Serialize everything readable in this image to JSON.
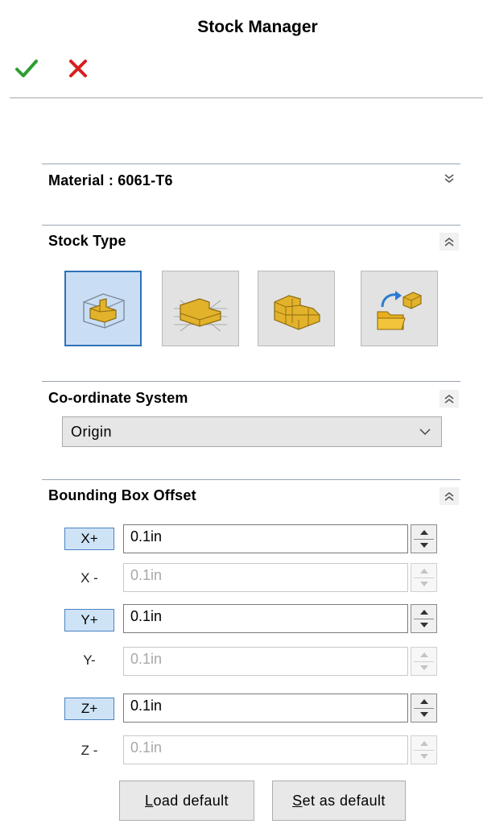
{
  "header": {
    "title": "Stock Manager"
  },
  "actions": {
    "ok_icon": "checkmark-icon",
    "cancel_icon": "close-icon",
    "ok_color": "#2e9e2e",
    "cancel_color": "#d81e1e"
  },
  "material": {
    "label": "Material : 6061-T6",
    "state": "collapsed"
  },
  "stock_type": {
    "label": "Stock Type",
    "state": "expanded",
    "options": [
      {
        "icon": "bounding-box-icon",
        "active": true
      },
      {
        "icon": "cylinder-stock-icon",
        "active": false
      },
      {
        "icon": "stl-stock-icon",
        "active": false
      },
      {
        "icon": "from-file-stock-icon",
        "active": false
      }
    ]
  },
  "coordinate_system": {
    "label": "Co-ordinate System",
    "state": "expanded",
    "selected": "Origin"
  },
  "bounding_box_offset": {
    "label": "Bounding Box Offset",
    "state": "expanded",
    "rows": [
      {
        "axis": "X+",
        "value": "0.1in",
        "enabled": true
      },
      {
        "axis": "X -",
        "value": "0.1in",
        "enabled": false
      },
      {
        "axis": "Y+",
        "value": "0.1in",
        "enabled": true
      },
      {
        "axis": "Y-",
        "value": "0.1in",
        "enabled": false
      },
      {
        "axis": "Z+",
        "value": "0.1in",
        "enabled": true
      },
      {
        "axis": "Z -",
        "value": "0.1in",
        "enabled": false
      }
    ]
  },
  "footer": {
    "load_default": {
      "mnemonic": "L",
      "rest": "oad default"
    },
    "set_default": {
      "mnemonic": "S",
      "rest": "et as default"
    }
  },
  "colors": {
    "accent": "#2e72b8",
    "active_fill": "#c9def5",
    "icon_gold": "#e2b22a"
  }
}
